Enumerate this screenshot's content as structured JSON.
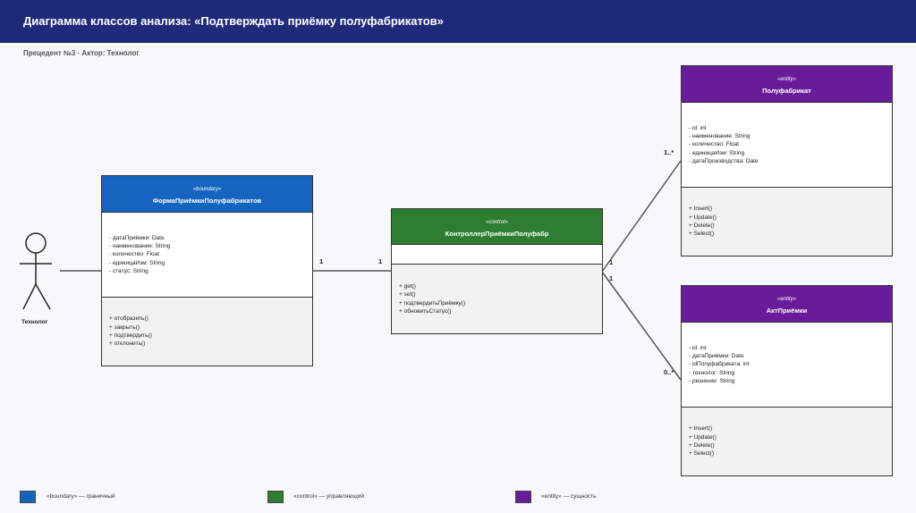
{
  "header": {
    "title": "Диаграмма классов анализа: «Подтверждать приёмку полуфабрикатов»"
  },
  "subtitle": "Прецедент №3 · Актор: Технолог",
  "actor": {
    "label": "Технолог"
  },
  "colors": {
    "boundary": "#1565c0",
    "control": "#2e7d32",
    "entity": "#6a1b9a",
    "header_bg": "#1f2a7a"
  },
  "classes": {
    "form": {
      "stereotype": "«boundary»",
      "name": "ФормаПриёмкиПолуфабрикатов",
      "attributes": [
        "- датаПриёмки: Date",
        "- наименование: String",
        "- количество: Float",
        "- единицаИзм: String",
        "- статус: String"
      ],
      "operations": [
        "+ отобразить()",
        "+ закрыть()",
        "+ подтвердить()",
        "+ отклонить()"
      ]
    },
    "controller": {
      "stereotype": "«control»",
      "name": "КонтроллерПриёмкиПолуфабр",
      "attributes": [],
      "operations": [
        "+ get()",
        "+ set()",
        "+ подтвердитьПриёмку()",
        "+ обновитьСтатус()"
      ]
    },
    "semi": {
      "stereotype": "«entity»",
      "name": "Полуфабрикат",
      "attributes": [
        "- id: int",
        "- наименование: String",
        "- количество: Float",
        "- единицаИзм: String",
        "- датаПроизводства: Date"
      ],
      "operations": [
        "+ Insert()",
        "+ Update()",
        "+ Delete()",
        "+ Select()"
      ]
    },
    "act": {
      "stereotype": "«entity»",
      "name": "АктПриёмки",
      "attributes": [
        "- id: int",
        "- датаПриёмки: Date",
        "- idПолуфабриката: int",
        "- технолог: String",
        "- решение: String"
      ],
      "operations": [
        "+ Insert()",
        "+ Update()",
        "+ Delete()",
        "+ Select()"
      ]
    }
  },
  "multiplicities": {
    "form_ctrl_left": "1",
    "form_ctrl_right": "1",
    "ctrl_semi_ctrl": "1",
    "ctrl_semi_semi": "1..*",
    "ctrl_act_ctrl": "1",
    "ctrl_act_act": "0..*"
  },
  "legend": {
    "boundary": "«boundary» — граничный",
    "control": "«control» — управляющий",
    "entity": "«entity» — сущность"
  }
}
